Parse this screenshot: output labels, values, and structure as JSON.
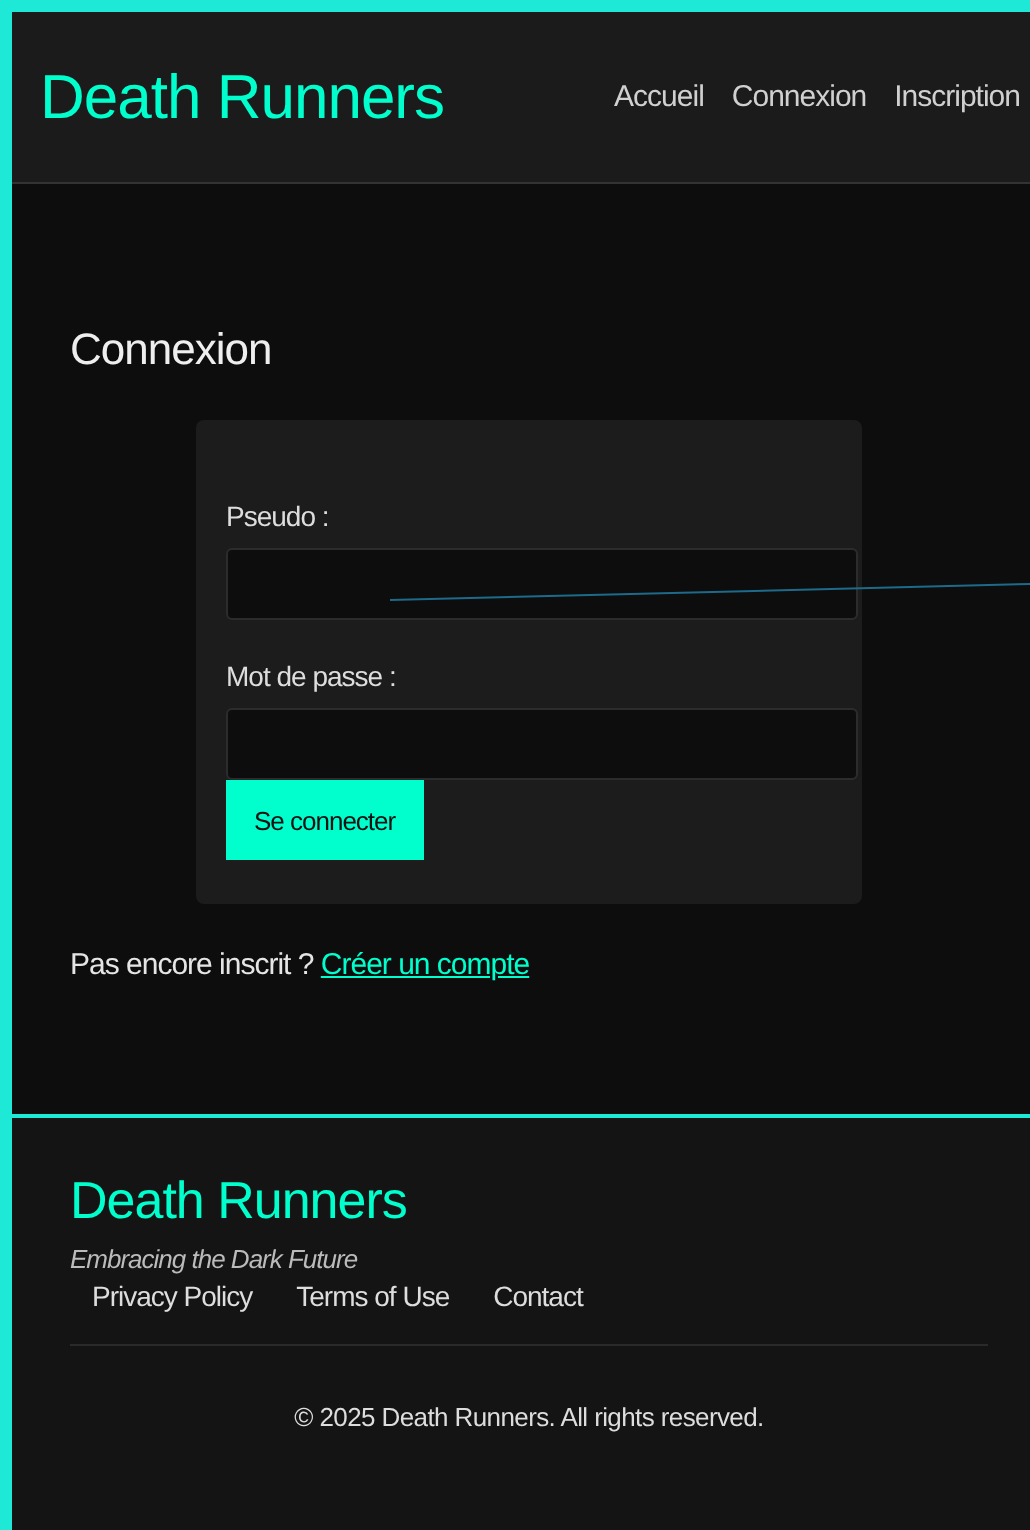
{
  "header": {
    "logo": "Death Runners",
    "nav": [
      {
        "label": "Accueil"
      },
      {
        "label": "Connexion"
      },
      {
        "label": "Inscription"
      }
    ]
  },
  "main": {
    "title": "Connexion",
    "form": {
      "fields": [
        {
          "label": "Pseudo :"
        },
        {
          "label": "Mot de passe :"
        }
      ],
      "submit": "Se connecter"
    },
    "signup_prompt": "Pas encore inscrit ?",
    "signup_link": "Créer un compte"
  },
  "footer": {
    "logo": "Death Runners",
    "tagline": "Embracing the Dark Future",
    "links": [
      {
        "label": "Privacy Policy"
      },
      {
        "label": "Terms of Use"
      },
      {
        "label": "Contact"
      }
    ],
    "copyright": "© 2025 Death Runners. All rights reserved."
  }
}
